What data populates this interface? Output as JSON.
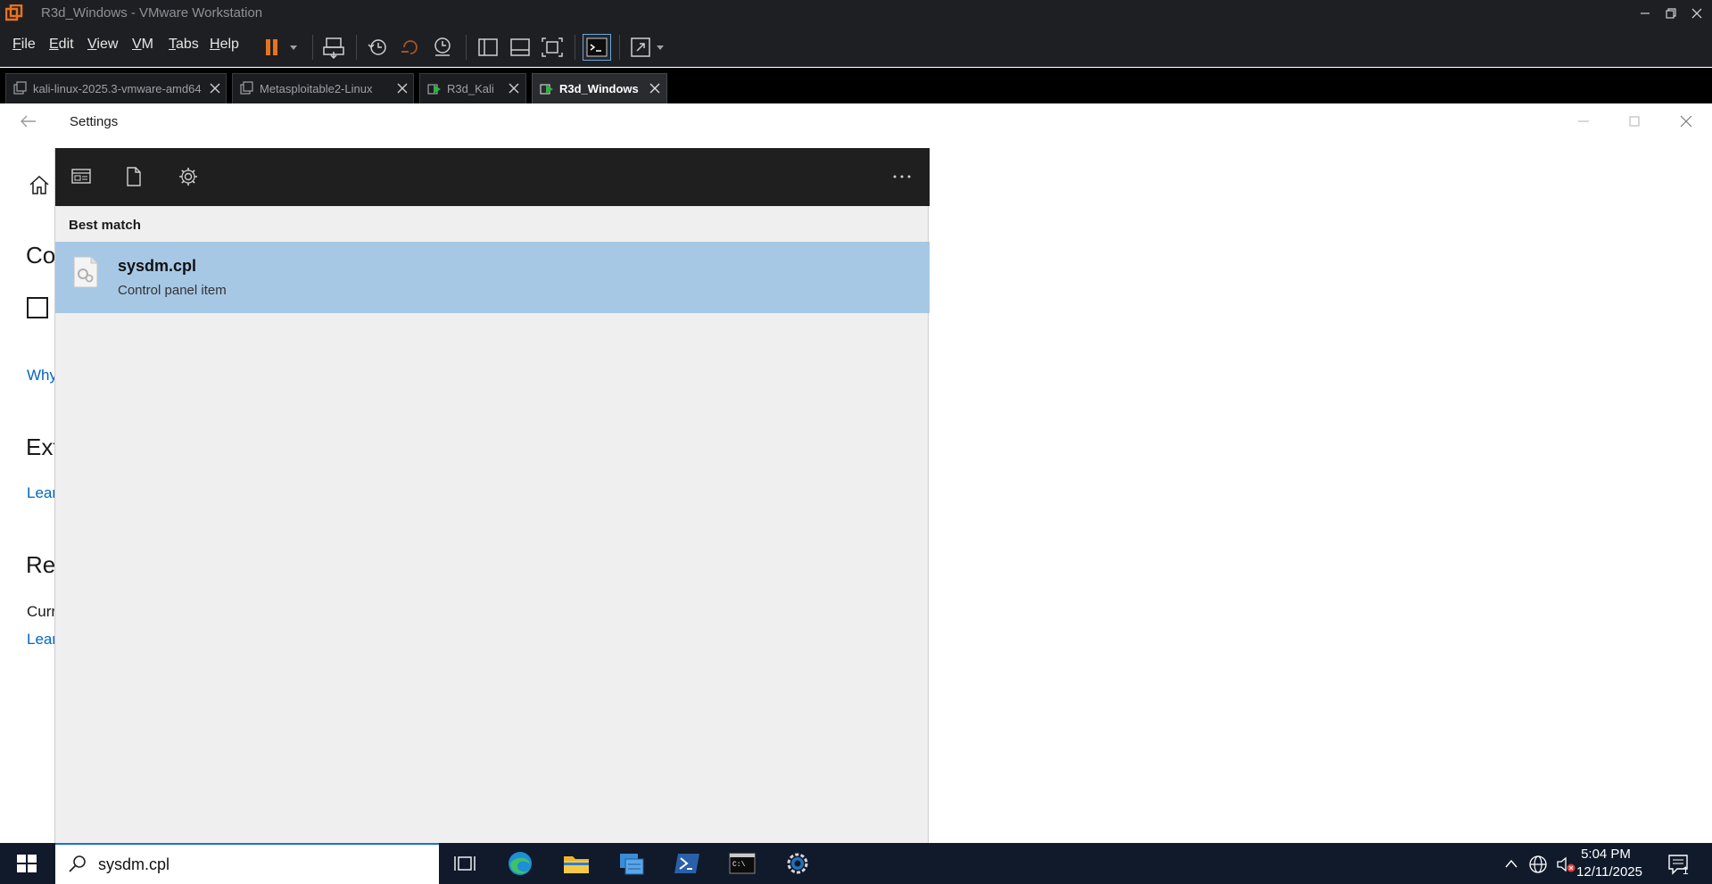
{
  "vm": {
    "window_title": "R3d_Windows - VMware Workstation",
    "menu": [
      {
        "accel": "F",
        "rest": "ile"
      },
      {
        "accel": "E",
        "rest": "dit"
      },
      {
        "accel": "V",
        "rest": "iew"
      },
      {
        "accel": "V",
        "rest": "M"
      },
      {
        "accel": "T",
        "rest": "abs"
      },
      {
        "accel": "H",
        "rest": "elp"
      }
    ],
    "tabs": [
      {
        "label": "kali-linux-2025.3-vmware-amd64",
        "active": false
      },
      {
        "label": "Metasploitable2-Linux",
        "active": false
      },
      {
        "label": "R3d_Kali",
        "active": false
      },
      {
        "label": "R3d_Windows",
        "active": true
      }
    ],
    "accent_color": "#e8731c"
  },
  "settings": {
    "title": "Settings",
    "fragments": {
      "heading1": "Co",
      "link1": "Why",
      "heading2": "Ext",
      "link2": "Lear",
      "heading3": "Rer",
      "text3": "Curr",
      "link3": "Lear"
    }
  },
  "search": {
    "best_match_header": "Best match",
    "result": {
      "title": "sysdm.cpl",
      "subtitle": "Control panel item",
      "icon": "control-panel-file-icon"
    },
    "query": "sysdm.cpl",
    "highlight_color": "#a7c8e5"
  },
  "taskbar": {
    "time": "5:04 PM",
    "date": "12/11/2025",
    "notification_count": "1",
    "apps": [
      "task-view-icon",
      "edge-icon",
      "file-explorer-icon",
      "server-manager-icon",
      "powershell-icon",
      "cmd-icon",
      "settings-icon"
    ]
  }
}
